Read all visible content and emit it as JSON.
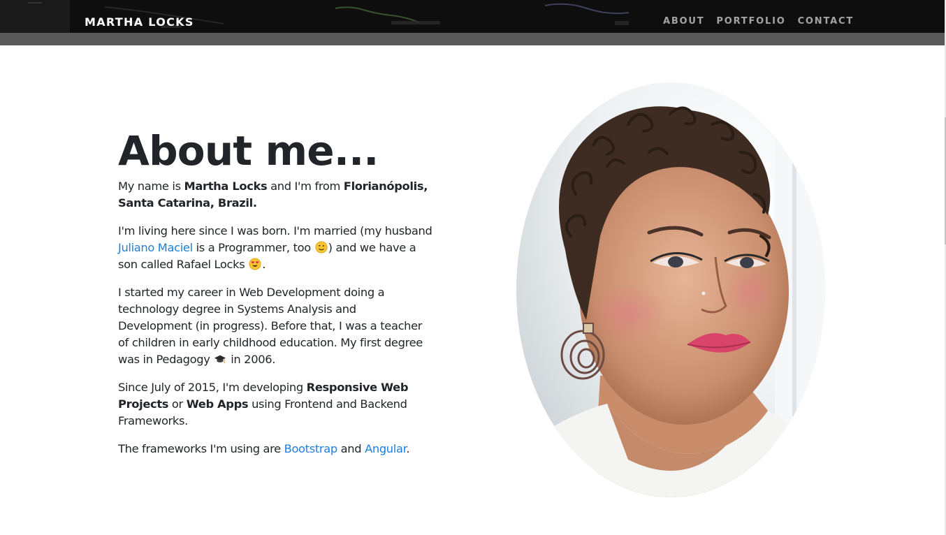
{
  "navbar": {
    "brand": "MARTHA LOCKS",
    "links": [
      "ABOUT",
      "PORTFOLIO",
      "CONTACT"
    ]
  },
  "about": {
    "heading": "About me...",
    "p1": {
      "t1": "My name is ",
      "name": "Martha Locks",
      "t2": " and I'm from ",
      "place": "Florianópolis, Santa Catarina, Brazil."
    },
    "p2": {
      "t1": "I'm living here since I was born. I'm married (my husband ",
      "husband_link": "Juliano Maciel",
      "t2": " is a Programmer, too ",
      "t3": ") and we have a son called Rafael Locks ",
      "t4": "."
    },
    "p3": {
      "t1": "I started my career in Web Development doing a technology degree in Systems Analysis and Development (in progress). Before that, I was a teacher of children in early childhood education. My first degree was in Pedagogy ",
      "t2": " in 2006."
    },
    "p4": {
      "t1": "Since July of 2015, I'm developing ",
      "b1": "Responsive Web Projects",
      "t2": " or ",
      "b2": "Web Apps",
      "t3": " using Frontend and Backend Frameworks."
    },
    "p5": {
      "t1": "The frameworks I'm using are ",
      "link1": "Bootstrap",
      "t2": " and ",
      "link2": "Angular",
      "t3": "."
    }
  },
  "icons": {
    "wink": "winking-face-emoji",
    "heart_eyes": "heart-eyes-emoji",
    "grad_cap": "graduation-cap-emoji"
  },
  "colors": {
    "navbar_bg": "#0d0d0d",
    "link": "#1b7fe0",
    "text": "#212529"
  }
}
